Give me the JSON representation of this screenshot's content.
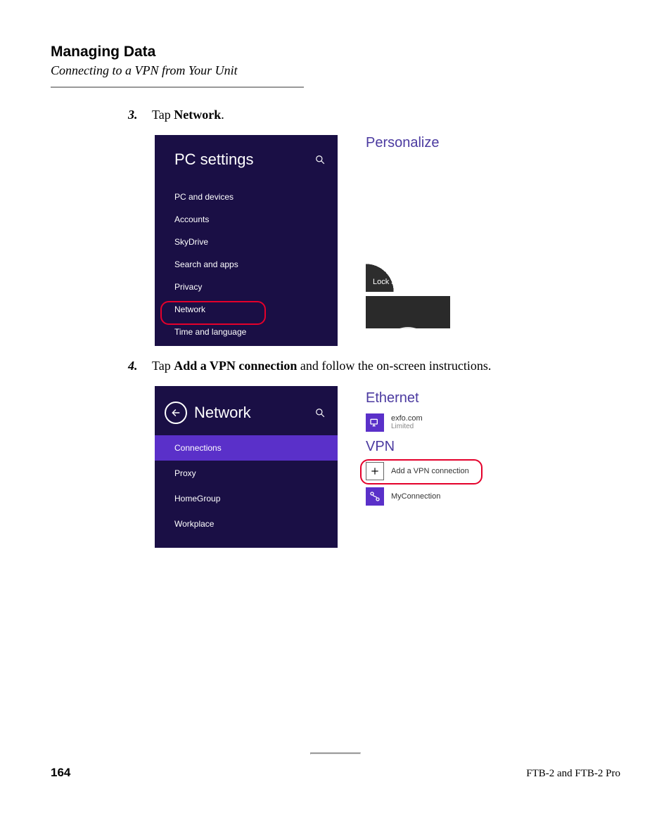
{
  "heading": "Managing Data",
  "subtitle": "Connecting to a VPN from Your Unit",
  "steps": {
    "s3": {
      "num": "3.",
      "pre": "Tap ",
      "bold": "Network",
      "post": "."
    },
    "s4": {
      "num": "4.",
      "pre": "Tap ",
      "bold": "Add a VPN connection",
      "post": " and follow the on-screen instructions."
    }
  },
  "pcsettings": {
    "title": "PC settings",
    "items": [
      "PC and devices",
      "Accounts",
      "SkyDrive",
      "Search and apps",
      "Privacy",
      "Network",
      "Time and language"
    ]
  },
  "personalize": {
    "title": "Personalize",
    "lock_label": "Lock screen"
  },
  "network": {
    "title": "Network",
    "items": [
      "Connections",
      "Proxy",
      "HomeGroup",
      "Workplace"
    ]
  },
  "rightpane": {
    "ethernet_title": "Ethernet",
    "eth_name": "exfo.com",
    "eth_status": "Limited",
    "vpn_title": "VPN",
    "add_vpn": "Add a VPN connection",
    "my_conn": "MyConnection"
  },
  "footer": {
    "page": "164",
    "right": "FTB-2 and FTB-2 Pro"
  }
}
